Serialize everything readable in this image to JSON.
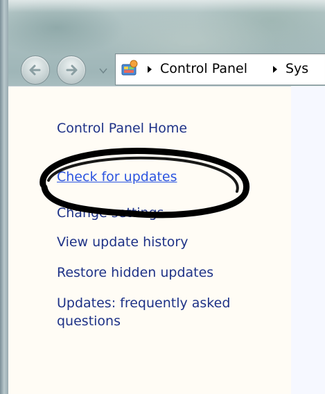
{
  "address_bar": {
    "crumbs": [
      "Control Panel",
      "Sys"
    ]
  },
  "nav_pane": {
    "links": [
      "Control Panel Home",
      "Check for updates",
      "Change settings",
      "View update history",
      "Restore hidden updates",
      "Updates: frequently asked questions"
    ]
  },
  "icons": {
    "back": "back-arrow-icon",
    "forward": "forward-arrow-icon",
    "history": "chevron-down-icon",
    "location": "control-panel-icon",
    "separator": "breadcrumb-arrow-icon"
  },
  "colors": {
    "link": "#1e3287",
    "link_hover": "#2b54e0",
    "nav_pane_background": "#fffcf5",
    "annotation": "#000000"
  }
}
